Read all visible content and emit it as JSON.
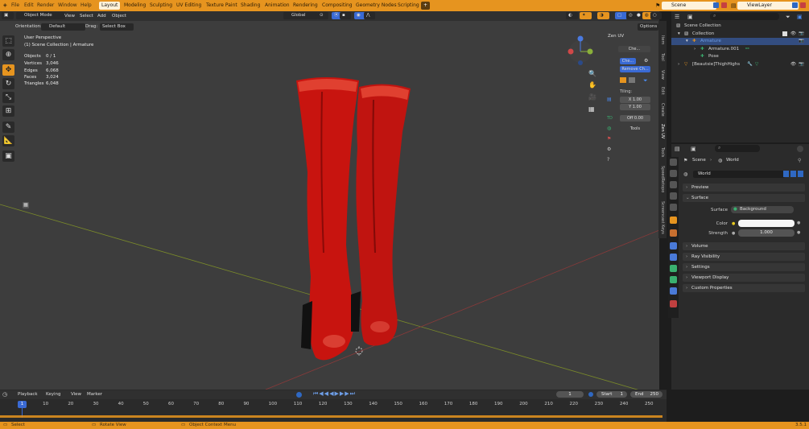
{
  "topbar": {
    "menus": [
      "File",
      "Edit",
      "Render",
      "Window",
      "Help"
    ],
    "workspaces": [
      "Layout",
      "Modeling",
      "Sculpting",
      "UV Editing",
      "Texture Paint",
      "Shading",
      "Animation",
      "Rendering",
      "Compositing",
      "Geometry Nodes",
      "Scripting"
    ],
    "active_workspace": "Layout",
    "add_tab": "+",
    "scene": "Scene",
    "view_layer": "ViewLayer"
  },
  "viewport_header": {
    "mode": "Object Mode",
    "menus": [
      "View",
      "Select",
      "Add",
      "Object"
    ],
    "transform_orientation": "Global",
    "options": "Options",
    "orientation_label": "Orientation:",
    "orientation_value": "Default",
    "drag_label": "Drag:",
    "drag_value": "Select Box"
  },
  "viewport_info": {
    "perspective": "User Perspective",
    "collection": "(1) Scene Collection | Armature",
    "stats": [
      {
        "label": "Objects",
        "value": "0 / 1"
      },
      {
        "label": "Vertices",
        "value": "3,046"
      },
      {
        "label": "Edges",
        "value": "6,068"
      },
      {
        "label": "Faces",
        "value": "3,024"
      },
      {
        "label": "Triangles",
        "value": "6,048"
      }
    ]
  },
  "zen_uv": {
    "title": "Zen UV",
    "check_label": "Che...",
    "check2_label": "Che...",
    "remove_label": "Remove Ch...",
    "tiling_label": "Tiling:",
    "x_label": "X",
    "x_value": "1.00",
    "y_label": "Y",
    "y_value": "1.00",
    "off_label": "Off",
    "off_value": "0.00",
    "tools_label": "Tools"
  },
  "side_tabs": [
    "Item",
    "Tool",
    "View",
    "Edit",
    "Create",
    "Zen UV",
    "Tools",
    "SpeedRetopo",
    "Screencast Keys"
  ],
  "outliner": {
    "rows": [
      {
        "label": "Scene Collection",
        "indent": 0
      },
      {
        "label": "Collection",
        "indent": 1
      },
      {
        "label": "Armature",
        "indent": 2,
        "selected": true
      },
      {
        "label": "Armature.001",
        "indent": 3
      },
      {
        "label": "Pose",
        "indent": 3
      },
      {
        "label": "[Beautsie]ThighHighs",
        "indent": 1
      }
    ]
  },
  "properties": {
    "breadcrumb_scene": "Scene",
    "breadcrumb_world": "World",
    "world_name": "World",
    "preview": "Preview",
    "surface": "Surface",
    "surface_label": "Surface",
    "surface_value": "Background",
    "color_label": "Color",
    "color_value": "#f5f5f5",
    "strength_label": "Strength",
    "strength_value": "1.000",
    "panels": [
      "Volume",
      "Ray Visibility",
      "Settings",
      "Viewport Display",
      "Custom Properties"
    ]
  },
  "timeline": {
    "menus": [
      "Playback",
      "Keying",
      "View",
      "Marker"
    ],
    "current_frame": "1",
    "start_label": "Start",
    "start_value": "1",
    "end_label": "End",
    "end_value": "250",
    "ticks": [
      "0",
      "10",
      "20",
      "30",
      "40",
      "50",
      "60",
      "70",
      "80",
      "90",
      "100",
      "110",
      "120",
      "130",
      "140",
      "150",
      "160",
      "170",
      "180",
      "190",
      "200",
      "210",
      "220",
      "230",
      "240",
      "250"
    ],
    "playhead": "1"
  },
  "statusbar": {
    "select": "Select",
    "rotate": "Rotate View",
    "context": "Object Context Menu",
    "version": "3.5.1"
  },
  "colors": {
    "accent": "#e6941f",
    "selection": "#334d80",
    "boots": "#c8140f"
  }
}
